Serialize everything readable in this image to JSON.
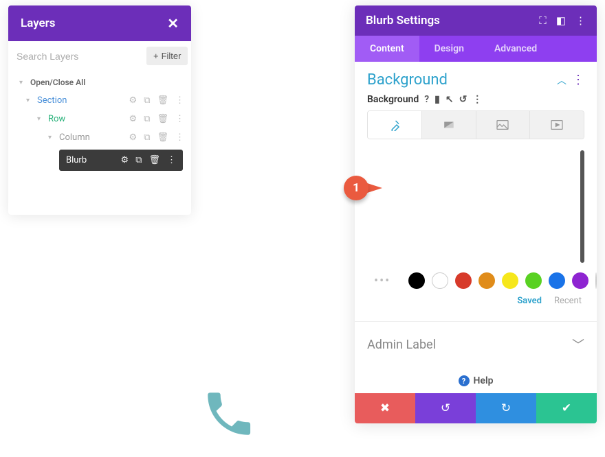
{
  "layers": {
    "title": "Layers",
    "search_placeholder": "Search Layers",
    "filter_label": "Filter",
    "open_close": "Open/Close All",
    "section": "Section",
    "row": "Row",
    "column": "Column",
    "blurb": "Blurb"
  },
  "settings": {
    "title": "Blurb Settings",
    "tabs": {
      "content": "Content",
      "design": "Design",
      "advanced": "Advanced"
    },
    "bg_title": "Background",
    "bg_label": "Background",
    "saved": "Saved",
    "recent": "Recent",
    "admin_label": "Admin Label",
    "help": "Help",
    "swatches": [
      "#000000",
      "#ffffff",
      "#d73a2a",
      "#e08c1a",
      "#f6e71b",
      "#59d122",
      "#1a73e8",
      "#8e24d1"
    ]
  },
  "callout": {
    "num": "1"
  }
}
